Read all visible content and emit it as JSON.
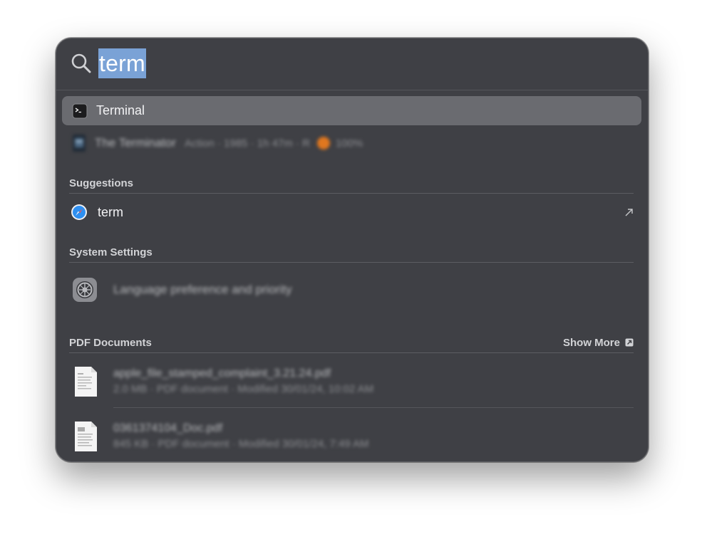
{
  "search": {
    "query": "term"
  },
  "top_hits": [
    {
      "label": "Terminal",
      "icon": "terminal-icon",
      "selected": true
    },
    {
      "label": "The Terminator",
      "icon": "movie-poster-icon",
      "meta": "Action · 1985 · 1h 47m · R",
      "score": "100%"
    }
  ],
  "suggestions": {
    "header": "Suggestions",
    "items": [
      {
        "label": "term",
        "icon": "safari-icon",
        "trailing_icon": "arrow-up-right-icon"
      }
    ]
  },
  "system_settings": {
    "header": "System Settings",
    "items": [
      {
        "label": "Language preference and priority",
        "icon": "settings-gear-icon"
      }
    ]
  },
  "pdf_documents": {
    "header": "PDF Documents",
    "show_more": "Show More",
    "items": [
      {
        "name": "apple_file_stamped_complaint_3.21.24.pdf",
        "meta": "2.0 MB · PDF document · Modified 30/01/24, 10:02 AM",
        "icon": "pdf-document-icon"
      },
      {
        "name": "0361374104_Doc.pdf",
        "meta": "845 KB · PDF document · Modified 30/01/24, 7:49 AM",
        "icon": "pdf-document-icon"
      }
    ]
  },
  "colors": {
    "panel_bg": "#3f4045",
    "selection_bg": "#6a6b70",
    "text_selection": "#7aa2d6"
  }
}
